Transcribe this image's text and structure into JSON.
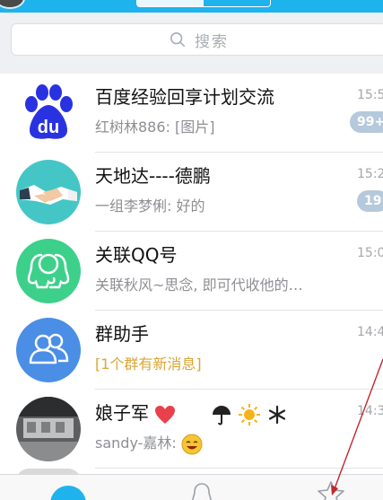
{
  "search": {
    "placeholder": "搜索"
  },
  "conversations": [
    {
      "title": "百度经验回享计划交流",
      "preview": "红树林886: [图片]",
      "time": "15:5",
      "badge": "99+",
      "avatar": "baidu-paw-logo"
    },
    {
      "title": "天地达----德鹏",
      "preview": "一组李梦俐: 好的",
      "time": "15:2",
      "badge": "19",
      "avatar": "handshake-icon"
    },
    {
      "title": "关联QQ号",
      "preview": "关联秋风~思念, 即可代收他的…",
      "time": "15:0",
      "badge": "",
      "avatar": "linked-qq-icon"
    },
    {
      "title": "群助手",
      "preview": "[1个群有新消息]",
      "time": "14:4",
      "badge": "",
      "avatar": "group-helper-icon"
    },
    {
      "title": "娘子军",
      "preview": "sandy-嘉林: ",
      "time": "14:3",
      "badge": "",
      "avatar": "photo-avatar"
    }
  ],
  "colors": {
    "accent": "#1fb3ee",
    "badge": "#b6c9dc",
    "notice": "#d9a634"
  }
}
